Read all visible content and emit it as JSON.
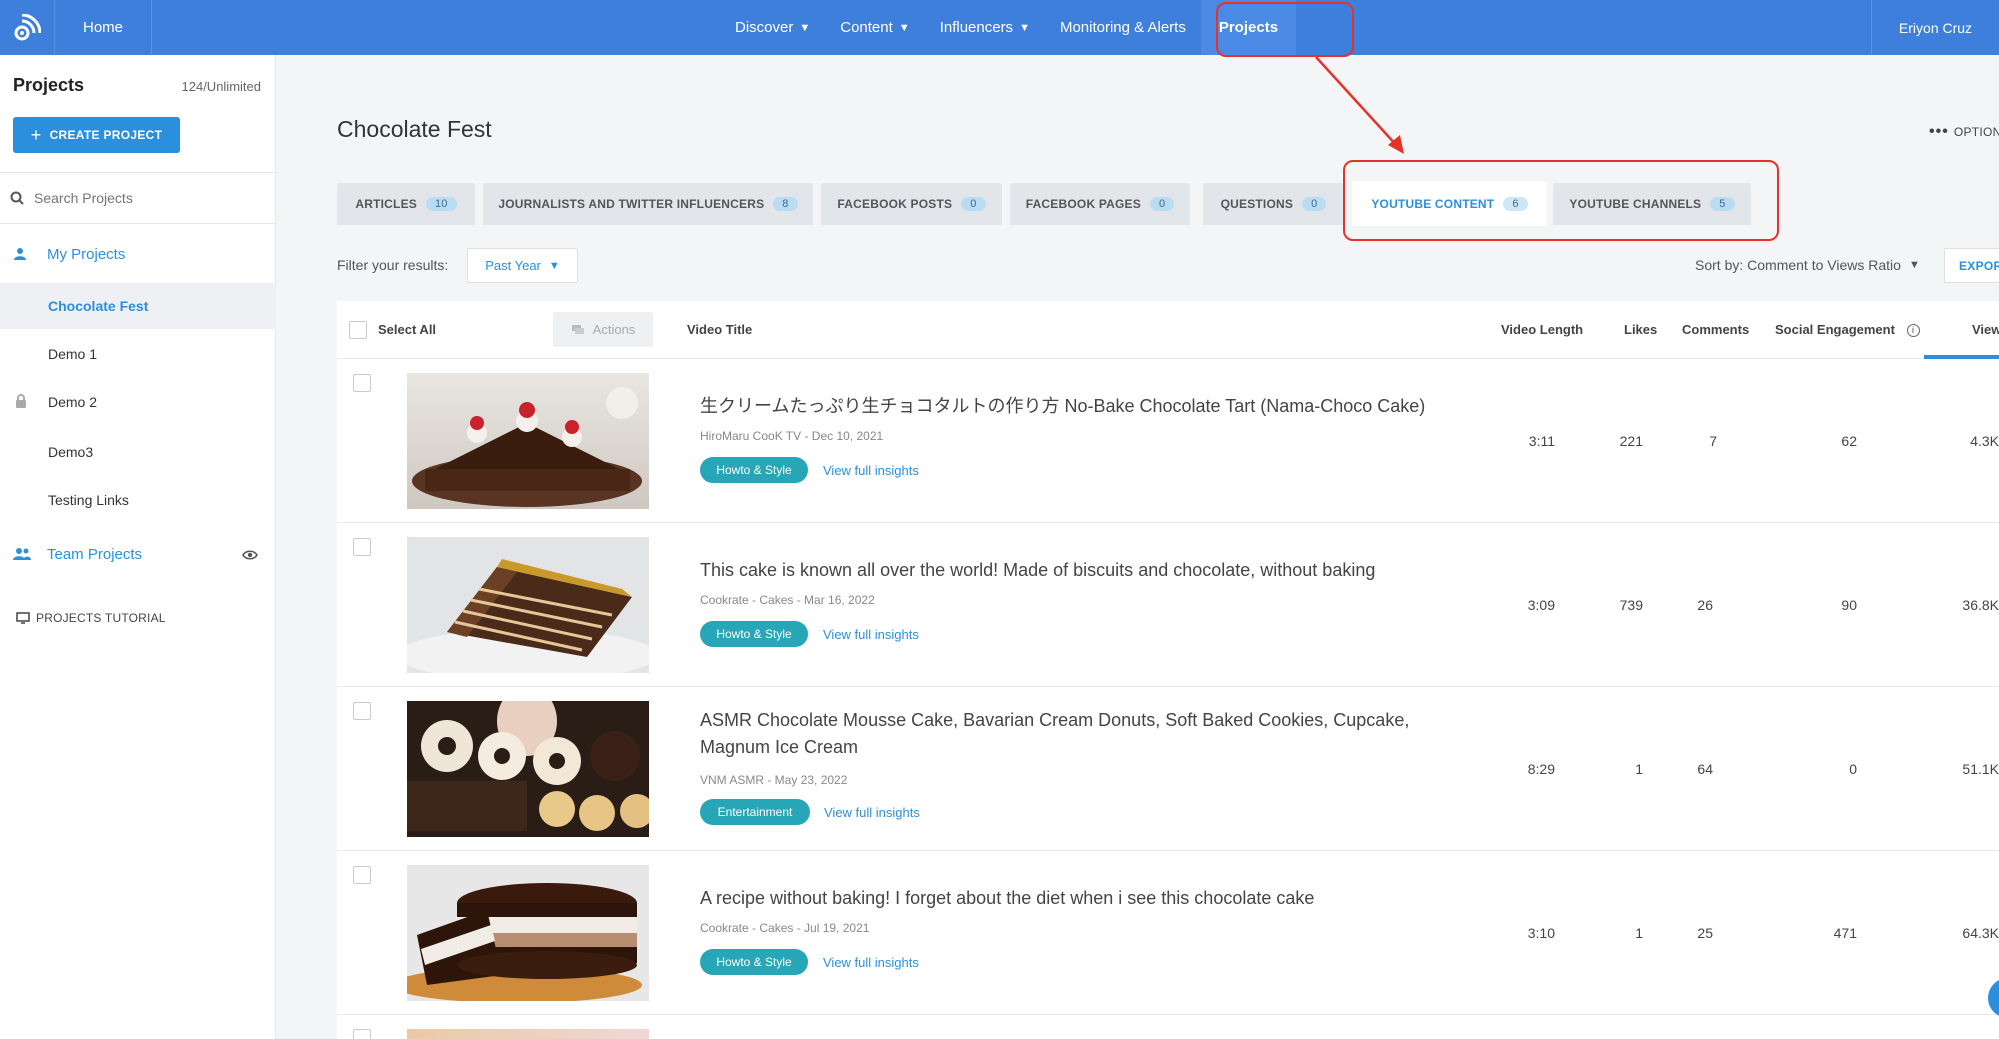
{
  "nav": {
    "home": "Home",
    "items": [
      {
        "label": "Discover",
        "dropdown": true
      },
      {
        "label": "Content",
        "dropdown": true
      },
      {
        "label": "Influencers",
        "dropdown": true
      },
      {
        "label": "Monitoring & Alerts",
        "dropdown": false
      },
      {
        "label": "Projects",
        "dropdown": false,
        "active": true
      }
    ],
    "user": "Eriyon Cruz"
  },
  "sidebar": {
    "title": "Projects",
    "count": "124/Unlimited",
    "create_label": "CREATE PROJECT",
    "search_placeholder": "Search Projects",
    "my_projects_label": "My Projects",
    "projects": [
      {
        "label": "Chocolate Fest",
        "active": true
      },
      {
        "label": "Demo 1"
      },
      {
        "label": "Demo 2",
        "locked": true
      },
      {
        "label": "Demo3"
      },
      {
        "label": "Testing Links"
      }
    ],
    "team_projects_label": "Team Projects",
    "tutorial_label": "PROJECTS TUTORIAL"
  },
  "main": {
    "title": "Chocolate Fest",
    "options_label": "OPTION",
    "tabs": [
      {
        "label": "ARTICLES",
        "count": "10"
      },
      {
        "label": "JOURNALISTS AND TWITTER INFLUENCERS",
        "count": "8"
      },
      {
        "label": "FACEBOOK POSTS",
        "count": "0"
      },
      {
        "label": "FACEBOOK PAGES",
        "count": "0"
      },
      {
        "label": "QUESTIONS",
        "count": "0"
      },
      {
        "label": "YOUTUBE CONTENT",
        "count": "6",
        "active": true
      },
      {
        "label": "YOUTUBE CHANNELS",
        "count": "5"
      }
    ],
    "filter_label": "Filter your results:",
    "filter_value": "Past Year",
    "sort_label": "Sort by: Comment to Views Ratio",
    "export_label": "EXPOR",
    "table": {
      "select_all": "Select All",
      "actions": "Actions",
      "headers": {
        "title": "Video Title",
        "length": "Video Length",
        "likes": "Likes",
        "comments": "Comments",
        "engagement": "Social Engagement",
        "views": "View"
      },
      "rows": [
        {
          "title": "生クリームたっぷり生チョコタルトの作り方 No-Bake Chocolate Tart (Nama-Choco Cake)",
          "meta": "HiroMaru CooK TV - Dec 10, 2021",
          "category": "Howto & Style",
          "link": "View full insights",
          "length": "3:11",
          "likes": "221",
          "comments": "7",
          "engagement": "62",
          "views": "4.3K"
        },
        {
          "title": "This cake is known all over the world! Made of biscuits and chocolate, without baking",
          "meta": "Cookrate - Cakes - Mar 16, 2022",
          "category": "Howto & Style",
          "link": "View full insights",
          "length": "3:09",
          "likes": "739",
          "comments": "26",
          "engagement": "90",
          "views": "36.8K"
        },
        {
          "title": "ASMR Chocolate Mousse Cake, Bavarian Cream Donuts, Soft Baked Cookies, Cupcake, Magnum Ice Cream",
          "meta": "VNM ASMR - May 23, 2022",
          "category": "Entertainment",
          "link": "View full insights",
          "length": "8:29",
          "likes": "1",
          "comments": "64",
          "engagement": "0",
          "views": "51.1K"
        },
        {
          "title": "A recipe without baking! I forget about the diet when i see this chocolate cake",
          "meta": "Cookrate - Cakes - Jul 19, 2021",
          "category": "Howto & Style",
          "link": "View full insights",
          "length": "3:10",
          "likes": "1",
          "comments": "25",
          "engagement": "471",
          "views": "64.3K"
        }
      ]
    }
  },
  "colors": {
    "nav_bg": "#3d7fdb",
    "accent": "#2c8fdd",
    "category": "#26a6b7",
    "annotation": "#e5332a"
  }
}
